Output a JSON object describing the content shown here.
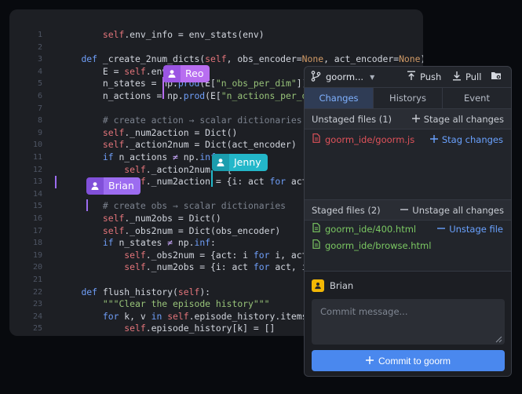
{
  "editor": {
    "lines": [
      {
        "n": "1",
        "tokens": [
          [
            "        "
          ],
          [
            "self",
            "self"
          ],
          [
            ".env_info = env_stats(env)"
          ]
        ]
      },
      {
        "n": "2",
        "tokens": [
          [
            ""
          ]
        ]
      },
      {
        "n": "3",
        "tokens": [
          [
            "    "
          ],
          [
            "def",
            "kw"
          ],
          [
            " _create_2num_dicts("
          ],
          [
            "self",
            "self"
          ],
          [
            ", obs_encoder="
          ],
          [
            "None",
            "num"
          ],
          [
            ", act_encoder="
          ],
          [
            "None",
            "num"
          ],
          [
            "):"
          ]
        ]
      },
      {
        "n": "4",
        "tokens": [
          [
            "        E = "
          ],
          [
            "self",
            "self"
          ],
          [
            ".env_i"
          ]
        ]
      },
      {
        "n": "5",
        "tokens": [
          [
            "        n_states = np."
          ],
          [
            "prod",
            "kw"
          ],
          [
            "(E["
          ],
          [
            "\"n_obs_per_dim\"",
            "str"
          ],
          [
            "])"
          ]
        ]
      },
      {
        "n": "6",
        "tokens": [
          [
            "        n_actions = np."
          ],
          [
            "prod",
            "kw"
          ],
          [
            "(E["
          ],
          [
            "\"n_actions_per_dim\"",
            "str"
          ],
          [
            "]"
          ]
        ]
      },
      {
        "n": "7",
        "tokens": [
          [
            ""
          ]
        ]
      },
      {
        "n": "8",
        "tokens": [
          [
            "        "
          ],
          [
            "# create action → scalar dictionaries",
            "com"
          ]
        ]
      },
      {
        "n": "9",
        "tokens": [
          [
            "        "
          ],
          [
            "self",
            "self"
          ],
          [
            "._num2action = Dict()"
          ]
        ]
      },
      {
        "n": "10",
        "tokens": [
          [
            "        "
          ],
          [
            "self",
            "self"
          ],
          [
            "._action2num = Dict(act_encoder)"
          ]
        ]
      },
      {
        "n": "11",
        "tokens": [
          [
            "        "
          ],
          [
            "if",
            "kw"
          ],
          [
            " n_actions "
          ],
          [
            "≠",
            "op"
          ],
          [
            " np."
          ],
          [
            "inf",
            "kw"
          ],
          [
            ":"
          ]
        ]
      },
      {
        "n": "12",
        "tokens": [
          [
            "            "
          ],
          [
            "self",
            "self"
          ],
          [
            "._action2num = {"
          ]
        ]
      },
      {
        "n": "13",
        "tokens": [
          [
            "            "
          ],
          [
            "self",
            "self"
          ],
          [
            "._num2action = {i: act "
          ],
          [
            "for",
            "kw"
          ],
          [
            " act, i"
          ]
        ]
      },
      {
        "n": "14",
        "tokens": [
          [
            ""
          ]
        ]
      },
      {
        "n": "15",
        "tokens": [
          [
            "        "
          ],
          [
            "# create obs → scalar dictionaries",
            "com"
          ]
        ]
      },
      {
        "n": "16",
        "tokens": [
          [
            "        "
          ],
          [
            "self",
            "self"
          ],
          [
            "._num2obs = Dict()"
          ]
        ]
      },
      {
        "n": "17",
        "tokens": [
          [
            "        "
          ],
          [
            "self",
            "self"
          ],
          [
            "._obs2num = Dict(obs_encoder)"
          ]
        ]
      },
      {
        "n": "18",
        "tokens": [
          [
            "        "
          ],
          [
            "if",
            "kw"
          ],
          [
            " n_states "
          ],
          [
            "≠",
            "op"
          ],
          [
            " np."
          ],
          [
            "inf",
            "kw"
          ],
          [
            ":"
          ]
        ]
      },
      {
        "n": "19",
        "tokens": [
          [
            "            "
          ],
          [
            "self",
            "self"
          ],
          [
            "._obs2num = {act: i "
          ],
          [
            "for",
            "kw"
          ],
          [
            " i, act "
          ],
          [
            "in",
            "kw"
          ]
        ]
      },
      {
        "n": "20",
        "tokens": [
          [
            "            "
          ],
          [
            "self",
            "self"
          ],
          [
            "._num2obs = {i: act "
          ],
          [
            "for",
            "kw"
          ],
          [
            " act, i "
          ],
          [
            "in",
            "kw"
          ]
        ]
      },
      {
        "n": "21",
        "tokens": [
          [
            ""
          ]
        ]
      },
      {
        "n": "22",
        "tokens": [
          [
            "    "
          ],
          [
            "def",
            "kw"
          ],
          [
            " flush_history("
          ],
          [
            "self",
            "self"
          ],
          [
            "):"
          ]
        ]
      },
      {
        "n": "23",
        "tokens": [
          [
            "        "
          ],
          [
            "\"\"\"Clear the episode history\"\"\"",
            "str"
          ]
        ]
      },
      {
        "n": "24",
        "tokens": [
          [
            "        "
          ],
          [
            "for",
            "kw"
          ],
          [
            " k, v "
          ],
          [
            "in",
            "kw"
          ],
          [
            " "
          ],
          [
            "self",
            "self"
          ],
          [
            ".episode_history.items():"
          ]
        ]
      },
      {
        "n": "25",
        "tokens": [
          [
            "            "
          ],
          [
            "self",
            "self"
          ],
          [
            ".episode_history[k] = []"
          ]
        ]
      }
    ],
    "collaborators": {
      "reo": {
        "name": "Reo",
        "icon": "user-icon",
        "color": "#b86ef0"
      },
      "jenny": {
        "name": "Jenny",
        "icon": "user-icon",
        "color": "#23b7c9"
      },
      "brian": {
        "name": "Brian",
        "icon": "user-icon",
        "color": "#9c6cf0"
      }
    }
  },
  "git": {
    "branch": {
      "icon": "git-branch-icon",
      "label": "goorm..."
    },
    "push_label": "Push",
    "pull_label": "Pull",
    "tabs": [
      {
        "label": "Changes",
        "active": true
      },
      {
        "label": "Historys",
        "active": false
      },
      {
        "label": "Event",
        "active": false
      }
    ],
    "unstaged": {
      "title": "Unstaged files (1)",
      "action_label": "Stage all changes",
      "files": [
        {
          "name": "goorm_ide/goorm.js",
          "color": "#e0525a",
          "action": "Stag changes"
        }
      ]
    },
    "staged": {
      "title": "Staged files (2)",
      "action_label": "Unstage all changes",
      "files": [
        {
          "name": "goorm_ide/400.html",
          "color": "#7bc862",
          "action": "Unstage file"
        },
        {
          "name": "goorm_ide/browse.html",
          "color": "#7bc862",
          "action": ""
        }
      ]
    },
    "commit": {
      "author": "Brian",
      "placeholder": "Commit message...",
      "button_label": "Commit to goorm",
      "button_color": "#4a88ee"
    }
  }
}
